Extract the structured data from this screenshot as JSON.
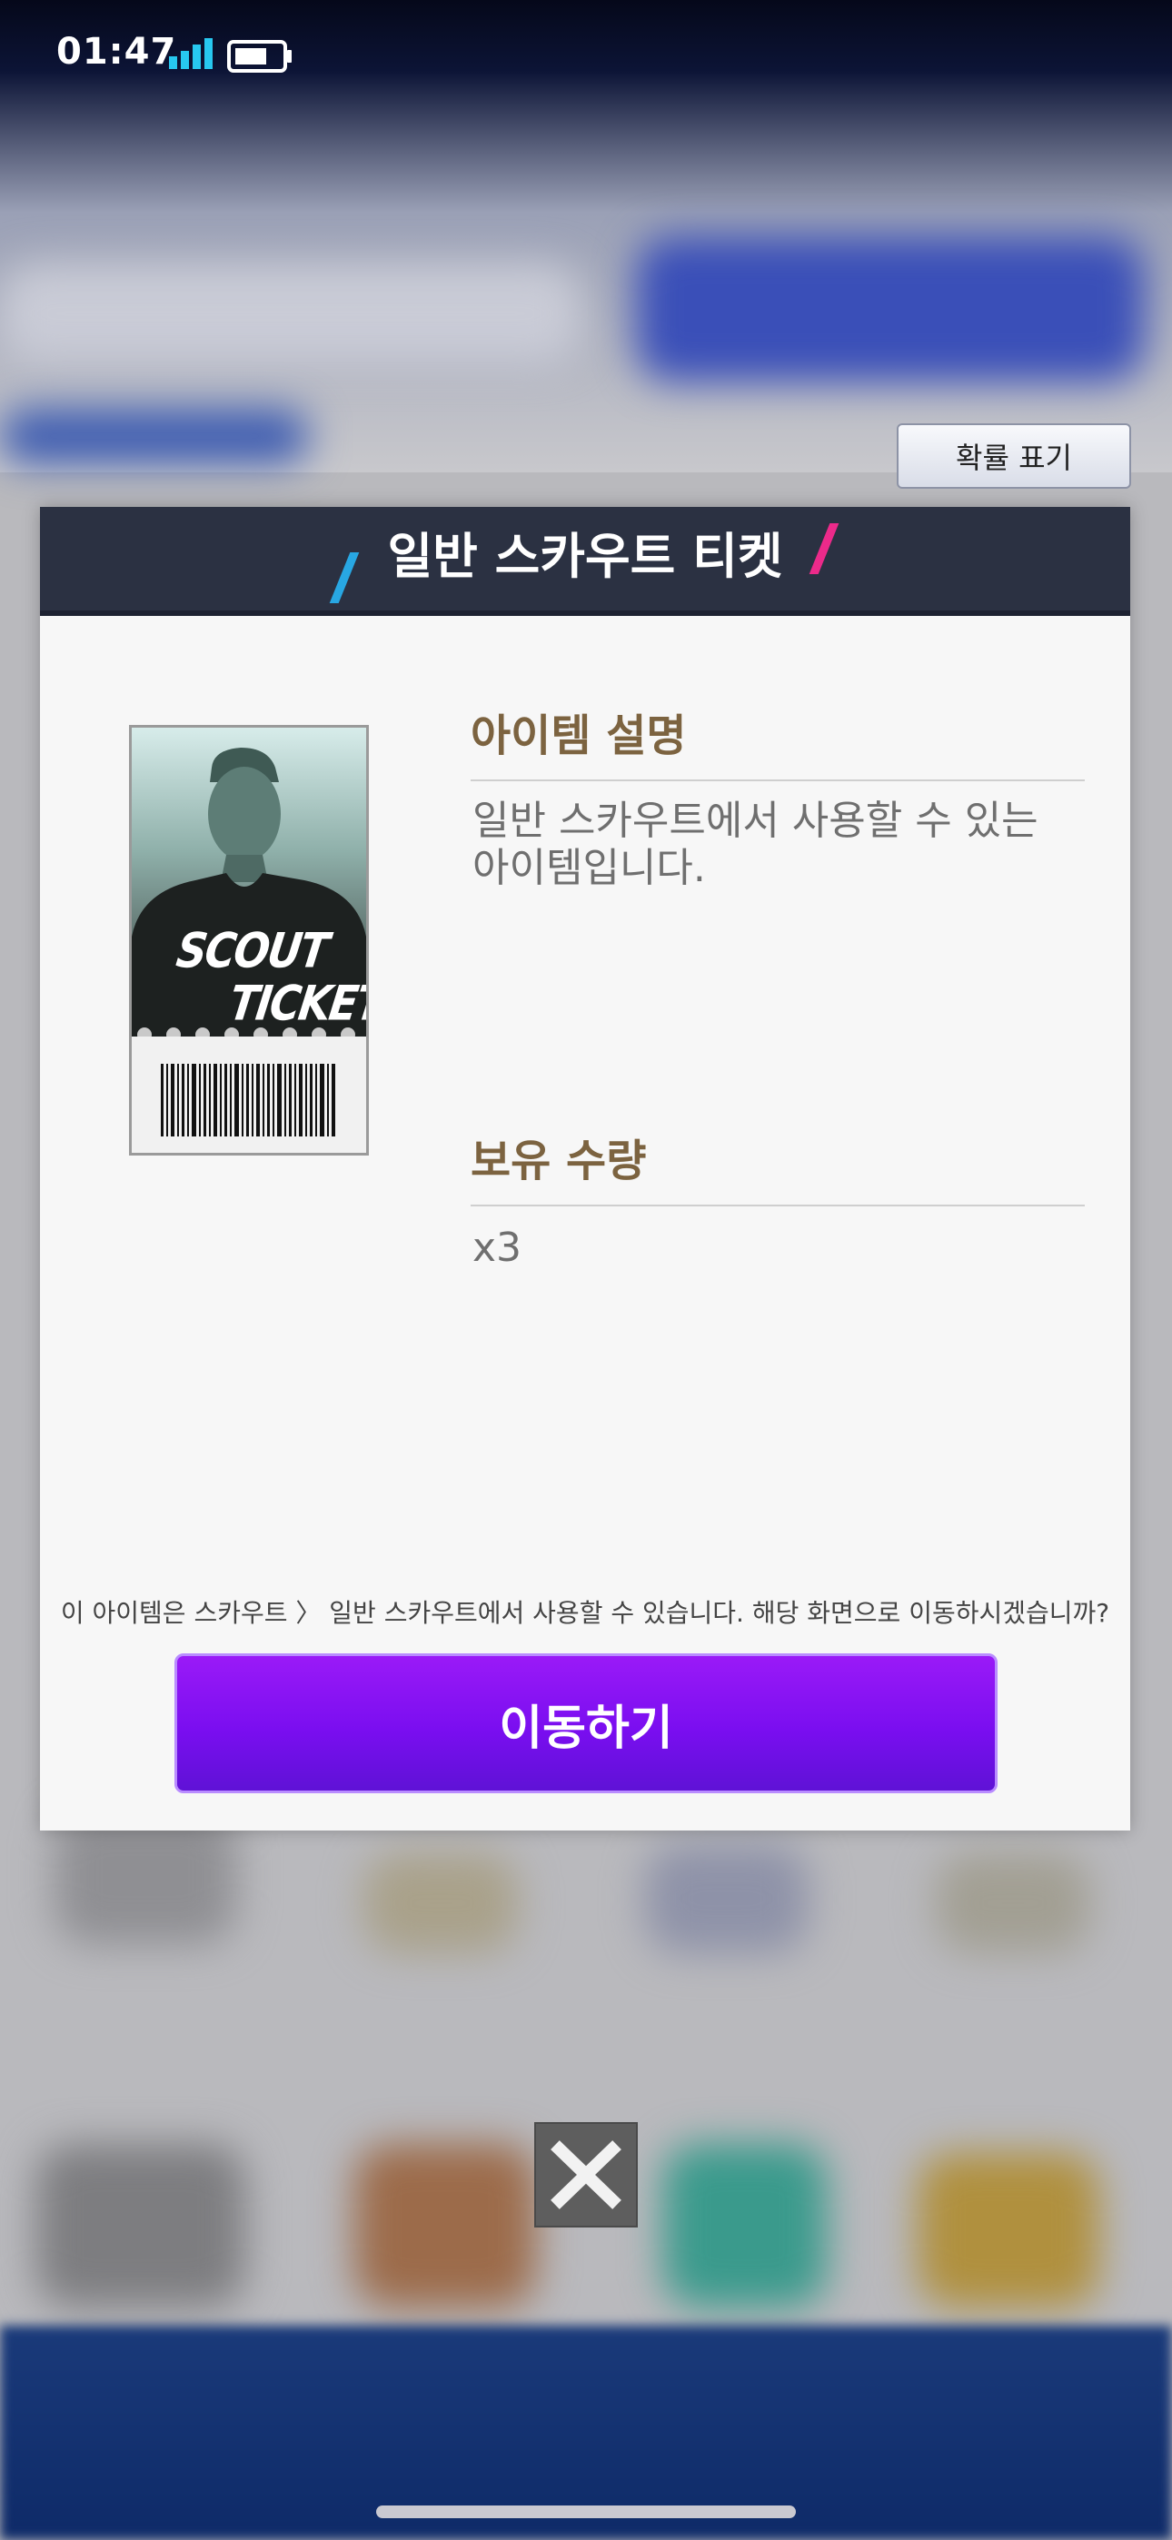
{
  "status_bar": {
    "time": "01:47"
  },
  "probability_button": {
    "label": "확률 표기"
  },
  "modal": {
    "title": "일반 스카우트 티켓",
    "ticket": {
      "line1": "SCOUT",
      "line2": "TICKET"
    },
    "description": {
      "heading": "아이템 설명",
      "line1": "일반 스카우트에서 사용할 수 있는",
      "line2": "아이템입니다."
    },
    "quantity": {
      "heading": "보유 수량",
      "value": "x3"
    },
    "notice": "이 아이템은 스카우트 〉 일반 스카우트에서 사용할 수 있습니다. 해당 화면으로 이동하시겠습니까?",
    "go_button": "이동하기"
  },
  "colors": {
    "header_bg": "#2b3142",
    "accent_purple": "#7a0ef0",
    "heading_gold": "#7c6340",
    "slash_blue": "#28a7e3",
    "slash_pink": "#ec2a8a"
  },
  "icons": [
    "signal-icon",
    "battery-icon",
    "close-icon",
    "barcode-icon"
  ]
}
